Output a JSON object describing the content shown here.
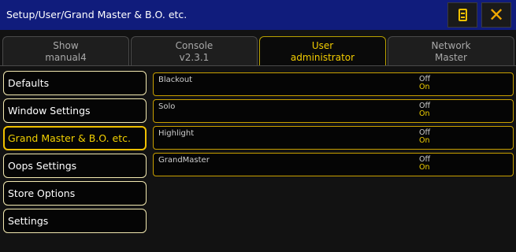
{
  "window": {
    "title": "Setup/User/Grand Master & B.O. etc.",
    "accent_color": "#f2c200",
    "titlebar_color": "#101c7c"
  },
  "tabs": [
    {
      "label": "Show",
      "value": "manual4",
      "active": false
    },
    {
      "label": "Console",
      "value": "v2.3.1",
      "active": false
    },
    {
      "label": "User",
      "value": "administrator",
      "active": true
    },
    {
      "label": "Network",
      "value": "Master",
      "active": false
    }
  ],
  "sidebar": {
    "items": [
      {
        "label": "Defaults",
        "selected": false
      },
      {
        "label": "Window Settings",
        "selected": false
      },
      {
        "label": "Grand Master & B.O. etc.",
        "selected": true
      },
      {
        "label": "Oops Settings",
        "selected": false
      },
      {
        "label": "Store Options",
        "selected": false
      },
      {
        "label": "Settings",
        "selected": false
      }
    ]
  },
  "settings": {
    "rows": [
      {
        "label": "Blackout",
        "off": "Off",
        "on": "On"
      },
      {
        "label": "Solo",
        "off": "Off",
        "on": "On"
      },
      {
        "label": "Highlight",
        "off": "Off",
        "on": "On"
      },
      {
        "label": "GrandMaster",
        "off": "Off",
        "on": "On"
      }
    ]
  },
  "icons": {
    "keyboard": "keyboard-icon",
    "close": "close-icon"
  }
}
